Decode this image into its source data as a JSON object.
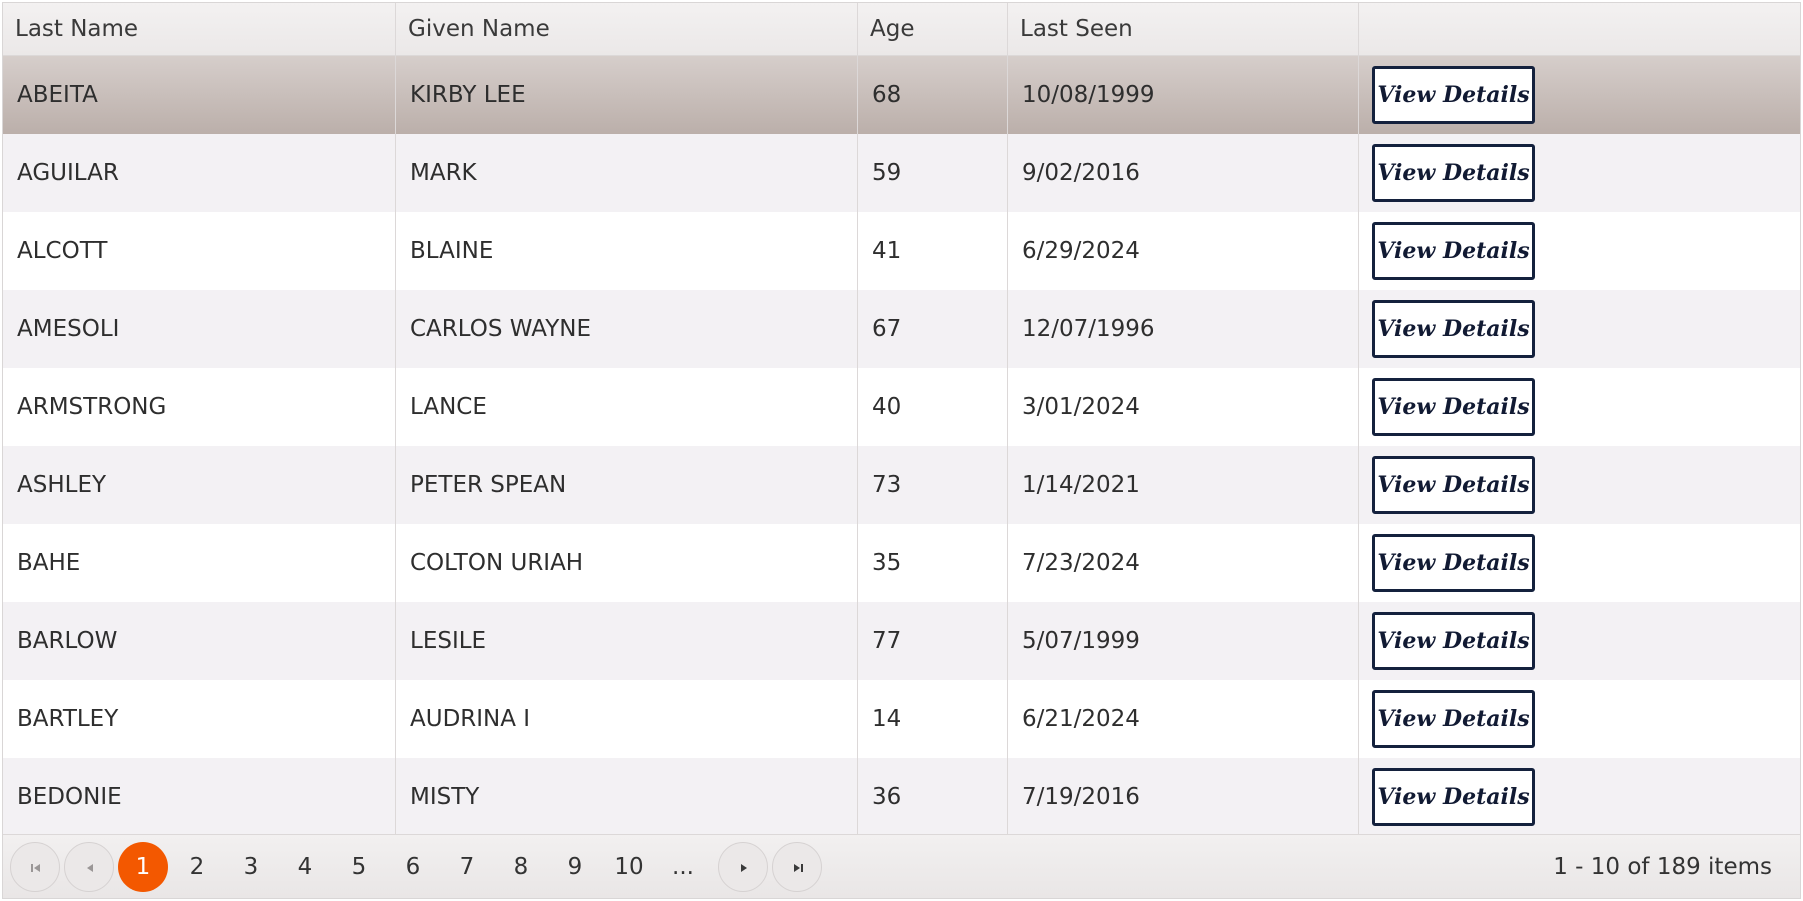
{
  "columns": {
    "last_name": "Last Name",
    "given_name": "Given Name",
    "age": "Age",
    "last_seen": "Last Seen"
  },
  "button_label": "View Details",
  "rows": [
    {
      "last_name": "ABEITA",
      "given_name": "KIRBY LEE",
      "age": "68",
      "last_seen": "10/08/1999",
      "view": "View Details"
    },
    {
      "last_name": "AGUILAR",
      "given_name": "MARK",
      "age": "59",
      "last_seen": "9/02/2016",
      "view": "View Details"
    },
    {
      "last_name": "ALCOTT",
      "given_name": "BLAINE",
      "age": "41",
      "last_seen": "6/29/2024",
      "view": "View Details"
    },
    {
      "last_name": "AMESOLI",
      "given_name": "CARLOS WAYNE",
      "age": "67",
      "last_seen": "12/07/1996",
      "view": "View Details"
    },
    {
      "last_name": "ARMSTRONG",
      "given_name": "LANCE",
      "age": "40",
      "last_seen": "3/01/2024",
      "view": "View Details"
    },
    {
      "last_name": "ASHLEY",
      "given_name": "PETER SPEAN",
      "age": "73",
      "last_seen": "1/14/2021",
      "view": "View Details"
    },
    {
      "last_name": "BAHE",
      "given_name": "COLTON URIAH",
      "age": "35",
      "last_seen": "7/23/2024",
      "view": "View Details"
    },
    {
      "last_name": "BARLOW",
      "given_name": "LESILE",
      "age": "77",
      "last_seen": "5/07/1999",
      "view": "View Details"
    },
    {
      "last_name": "BARTLEY",
      "given_name": "AUDRINA I",
      "age": "14",
      "last_seen": "6/21/2024",
      "view": "View Details"
    },
    {
      "last_name": "BEDONIE",
      "given_name": "MISTY",
      "age": "36",
      "last_seen": "7/19/2016",
      "view": "View Details"
    }
  ],
  "pager": {
    "pages": [
      "1",
      "2",
      "3",
      "4",
      "5",
      "6",
      "7",
      "8",
      "9",
      "10",
      "..."
    ],
    "current_page": "1",
    "info": "1 - 10 of 189 items",
    "icons": {
      "first": "first-page-icon",
      "prev": "previous-page-icon",
      "next": "next-page-icon",
      "last": "last-page-icon"
    }
  },
  "colors": {
    "accent": "#f35800",
    "button_border": "#14213d",
    "selected_row": "#c5bbb7",
    "alt_row": "#f3f1f4"
  }
}
